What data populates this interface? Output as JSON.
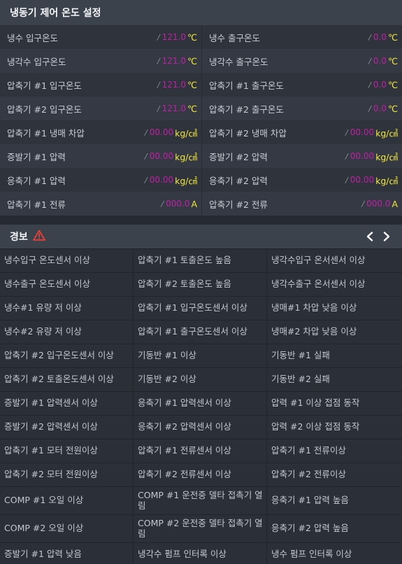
{
  "temp_panel": {
    "title": "냉동기 제어 온도 설정",
    "rows": [
      {
        "l_label": "냉수 입구온도",
        "l_value": "121.0",
        "l_unit": "℃",
        "r_label": "냉수 출구온도",
        "r_value": "0.0",
        "r_unit": "℃"
      },
      {
        "l_label": "냉각수 입구온도",
        "l_value": "121.0",
        "l_unit": "℃",
        "r_label": "냉각수 출구온도",
        "r_value": "0.0",
        "r_unit": "℃"
      },
      {
        "l_label": "압축기 #1 입구온도",
        "l_value": "121.0",
        "l_unit": "℃",
        "r_label": "압축기 #1 출구온도",
        "r_value": "0.0",
        "r_unit": "℃"
      },
      {
        "l_label": "압축기 #2 입구온도",
        "l_value": "121.0",
        "l_unit": "℃",
        "r_label": "압축기 #2 출구온도",
        "r_value": "0.0",
        "r_unit": "℃"
      },
      {
        "l_label": "압축기 #1 냉매 차압",
        "l_value": "00.00",
        "l_unit": "kg/㎠",
        "r_label": "압축기 #2 냉매 차압",
        "r_value": "00.00",
        "r_unit": "kg/㎠"
      },
      {
        "l_label": "증발기 #1 압력",
        "l_value": "00.00",
        "l_unit": "kg/㎠",
        "r_label": "증발기 #2 압력",
        "r_value": "00.00",
        "r_unit": "kg/㎠"
      },
      {
        "l_label": "응축기 #1 압력",
        "l_value": "00.00",
        "l_unit": "kg/㎠",
        "r_label": "응축기 #2 압력",
        "r_value": "00.00",
        "r_unit": "kg/㎠"
      },
      {
        "l_label": "압축기 #1 전류",
        "l_value": "000.0",
        "l_unit": "A",
        "r_label": "압축기 #2 전류",
        "r_value": "000.0",
        "r_unit": "A"
      }
    ]
  },
  "alarm_panel": {
    "title": "경보",
    "warning_icon": "warning-triangle-icon",
    "prev_icon": "chevron-left-icon",
    "next_icon": "chevron-right-icon",
    "rows": [
      [
        "냉수입구 온도센서 이상",
        "압축기 #1 토출온도 높음",
        "냉각수입구 온서센서 이상"
      ],
      [
        "냉수출구 온도센서 이상",
        "압축기 #2 토출온도 높음",
        "냉각수출구 온서센서 이상"
      ],
      [
        "냉수#1 유량 저 이상",
        "압축기 #1 입구온도센서 이상",
        "냉매#1 차압 낮음 이상"
      ],
      [
        "냉수#2 유량 저 이상",
        "압축기 #1 출구온도센서 이상",
        "냉매#2 차압 낮음 이상"
      ],
      [
        "압축기 #2 입구온도센서 이상",
        "기동반 #1 이상",
        "기동반 #1 실패"
      ],
      [
        "압축기 #2 토출온도센서 이상",
        "기동반 #2 이상",
        "기동반 #2 실패"
      ],
      [
        "증발기 #1 압력센서 이상",
        "응축기 #1 압력센서 이상",
        "압력 #1 이상 접점 동작"
      ],
      [
        "증발기 #2 압력센서 이상",
        "응축기 #2 압력센서 이상",
        "압력 #2 이상 접점 동작"
      ],
      [
        "압축기 #1 모터 전원이상",
        "압축기 #1 전류센서 이상",
        "압축기 #1 전류이상"
      ],
      [
        "압축기 #2 모터 전원이상",
        "압축기 #2 전류센서 이상",
        "압축기 #2 전류이상"
      ],
      [
        "COMP #1 오일 이상",
        "COMP #1 운전중 델타 접촉기 열림",
        "응축기 #1 압력 높음"
      ],
      [
        "COMP #2 오일 이상",
        "COMP #2 운전중 델타 접촉기 열림",
        "응축기 #2 압력 높음"
      ],
      [
        "증발기 #1 압력 낮음",
        "냉각수 펌프 인터록 이상",
        "냉수 펌프 인터록 이상"
      ]
    ]
  },
  "colors": {
    "value": "#c21fa8",
    "unit": "#f3e83c",
    "warning": "#e8403a"
  }
}
